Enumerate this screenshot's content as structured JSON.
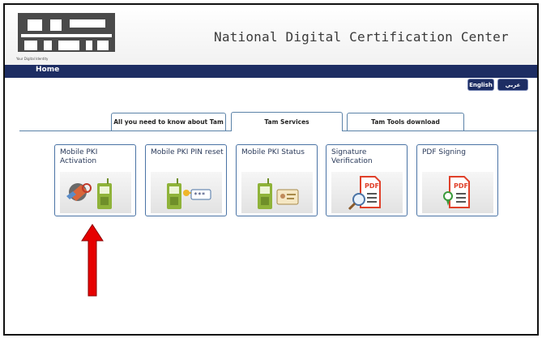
{
  "header": {
    "site_title": "National Digital Certification Center",
    "logo_tagline": "Your Digital Identity"
  },
  "nav": {
    "home": "Home"
  },
  "language": {
    "english": "English",
    "arabic": "عربي"
  },
  "tabs": [
    {
      "label": "All you need to know about Tam",
      "active": false
    },
    {
      "label": "Tam Services",
      "active": true
    },
    {
      "label": "Tam Tools download",
      "active": false
    }
  ],
  "services": [
    {
      "label": "Mobile PKI Activation",
      "icon": "key-phone-icon"
    },
    {
      "label": "Mobile PKI PIN reset",
      "icon": "pin-reset-icon"
    },
    {
      "label": "Mobile PKI Status",
      "icon": "phone-id-card-icon"
    },
    {
      "label": "Signature Verification",
      "icon": "pdf-magnifier-icon"
    },
    {
      "label": "PDF Signing",
      "icon": "pdf-signing-icon"
    }
  ],
  "colors": {
    "navbar": "#1d2d63",
    "tile_border": "#4a73a5",
    "tab_border": "#5b82a8",
    "arrow": "#e60000",
    "phone_green": "#8fb33a",
    "pdf_red": "#e0402a"
  }
}
